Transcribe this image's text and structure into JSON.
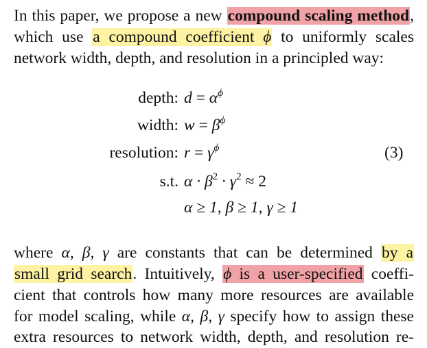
{
  "paragraph1": {
    "l1_pre": "In this paper, we propose a new ",
    "l1_hl": "compound scaling method",
    "l1_post": ",",
    "l2_pre": "which use ",
    "l2_hl": "a compound coefficient ",
    "l2_hl_math": "ϕ",
    "l2_post": " to uniformly scales",
    "l3": "network width, depth, and resolution in a principled way:"
  },
  "equation": {
    "number": "(3)",
    "rows": [
      {
        "label": "depth:",
        "lhs": "d",
        "rel": " = ",
        "base": "α",
        "exp": "ϕ"
      },
      {
        "label": "width:",
        "lhs": "w",
        "rel": " = ",
        "base": "β",
        "exp": "ϕ"
      },
      {
        "label": "resolution:",
        "lhs": "r",
        "rel": " = ",
        "base": "γ",
        "exp": "ϕ"
      }
    ],
    "st_label": "s.t.",
    "st_a": "α · β",
    "st_sq1": "2",
    "st_b": " · γ",
    "st_sq2": "2",
    "st_c": " ≈ 2",
    "constraint": "α ≥ 1, β ≥ 1, γ ≥ 1"
  },
  "paragraph2": {
    "l1_pre": "where ",
    "l1_math": "α, β, γ",
    "l1_mid": " are constants that can be determined ",
    "l1_hl": "by a",
    "l2_hl": "small grid search",
    "l2_mid": ". Intuitively, ",
    "l2_hl2_math": "ϕ",
    "l2_hl2": " is a user-specified",
    "l2_post": " coeffi-",
    "l3": "cient that controls how many more resources are available",
    "l4_pre": "for model scaling, while ",
    "l4_math": "α, β, γ",
    "l4_post": " specify how to assign these",
    "l5": "extra resources to network width, depth, and resolution re-"
  },
  "colors": {
    "highlight_red": "#f1a2a6",
    "highlight_yellow": "#fdf3a3"
  }
}
